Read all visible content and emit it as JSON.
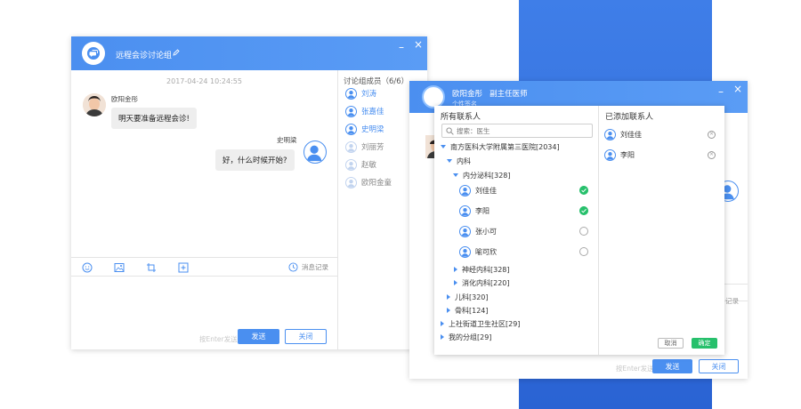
{
  "chat_window": {
    "title": "远程会诊讨论组",
    "minimize": "–",
    "close": "×",
    "timestamp": "2017-04-24 10:24:55",
    "messages": [
      {
        "sender": "欧阳金彤",
        "text": "明天要准备远程会诊!"
      },
      {
        "sender": "史明梁",
        "text": "好，什么时候开始?"
      }
    ],
    "toolbar": {
      "history": "消息记录"
    },
    "hint": "按Enter发送",
    "send": "发送",
    "close_btn": "关闭",
    "members_title": "讨论组成员（6/6）",
    "members": [
      "刘涛",
      "张嘉佳",
      "史明梁",
      "刘丽芳",
      "赵敏",
      "欧阳金童"
    ]
  },
  "profile_window": {
    "name": "欧阳金彤   副主任医师",
    "signature": "个性签名",
    "minimize": "–",
    "close": "×",
    "history": "记录",
    "hint": "按Enter发送",
    "send": "发送",
    "close_btn": "关闭"
  },
  "contact_dialog": {
    "all_contacts": "所有联系人",
    "search_placeholder": "搜索：医生",
    "tree": {
      "hospital": "南方医科大学附属第三医院[2034]",
      "internal": "内科",
      "endocrine": "内分泌科[328]",
      "people": [
        {
          "name": "刘佳佳",
          "checked": true
        },
        {
          "name": "李阳",
          "checked": true
        },
        {
          "name": "张小可",
          "checked": false
        },
        {
          "name": "喻可欣",
          "checked": false
        }
      ],
      "neuro": "神经内科[328]",
      "digest": "消化内科[220]",
      "pediatrics": "儿科[320]",
      "ortho": "骨科[124]",
      "community": "上社街道卫生社区[29]",
      "mygroup": "我的分组[29]"
    },
    "added_title": "已添加联系人",
    "added": [
      "刘佳佳",
      "李阳"
    ],
    "cancel": "取消",
    "confirm": "确定"
  },
  "colors": {
    "accent": "#4a8ff0",
    "band": "#2f6bd9",
    "check": "#27c06c"
  }
}
